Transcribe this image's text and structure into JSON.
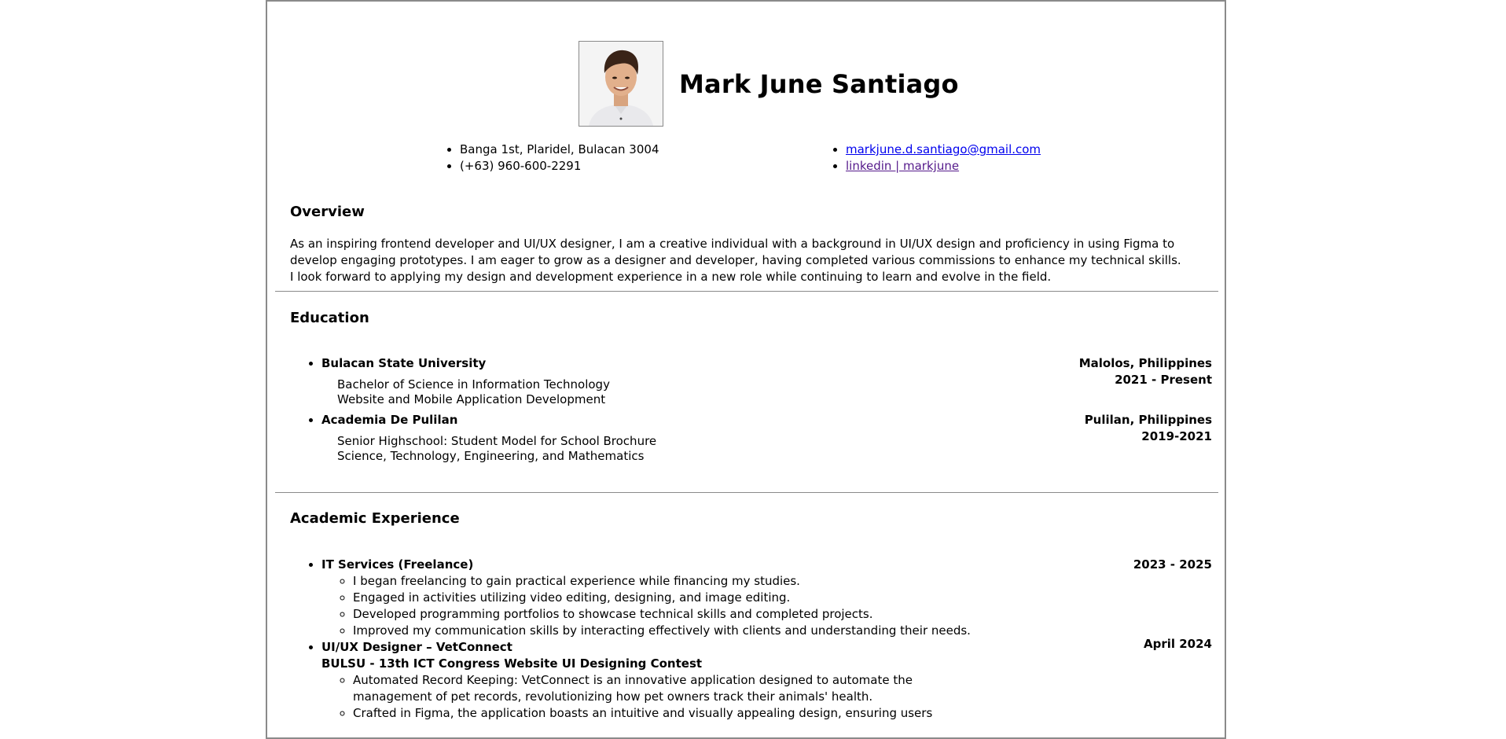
{
  "profile": {
    "name": "Mark June Santiago",
    "photo_alt": "profile-photo"
  },
  "contact": {
    "address": "Banga 1st, Plaridel, Bulacan 3004",
    "phone": "(+63) 960-600-2291",
    "email": "markjune.d.santiago@gmail.com",
    "linkedin": "linkedin | markjune"
  },
  "overview": {
    "title": "Overview",
    "text": "As an inspiring frontend developer and UI/UX designer, I am a creative individual with a background in UI/UX design and proficiency in using Figma to develop engaging prototypes. I am eager to grow as a designer and developer, having completed various commissions to enhance my technical skills. I look forward to applying my design and development experience in a new role while continuing to learn and evolve in the field."
  },
  "education": {
    "title": "Education",
    "items": [
      {
        "school": "Bulacan State University",
        "location": "Malolos, Philippines",
        "years": "2021 - Present",
        "line1": "Bachelor of Science in Information Technology",
        "line2": "Website and Mobile Application Development"
      },
      {
        "school": "Academia De Pulilan",
        "location": "Pulilan, Philippines",
        "years": "2019-2021",
        "line1": "Senior Highschool: Student Model for School Brochure",
        "line2": "Science, Technology, Engineering, and Mathematics"
      }
    ]
  },
  "experience": {
    "title": "Academic Experience",
    "items": [
      {
        "role": "IT Services (Freelance)",
        "date": "2023 - 2025",
        "bullets": [
          "I began freelancing to gain practical experience while financing my studies.",
          "Engaged in activities utilizing video editing, designing, and image editing.",
          "Developed programming portfolios to showcase technical skills and completed projects.",
          "Improved my communication skills by interacting effectively with clients and understanding their needs."
        ]
      },
      {
        "role": "UI/UX Designer – VetConnect",
        "subtitle": "BULSU - 13th ICT Congress Website UI Designing Contest",
        "date": "April 2024",
        "bullets": [
          "Automated Record Keeping: VetConnect is an innovative application designed to automate the management of pet records, revolutionizing how pet owners track their animals' health.",
          "Crafted in Figma, the application boasts an intuitive and visually appealing design, ensuring users"
        ]
      }
    ]
  }
}
